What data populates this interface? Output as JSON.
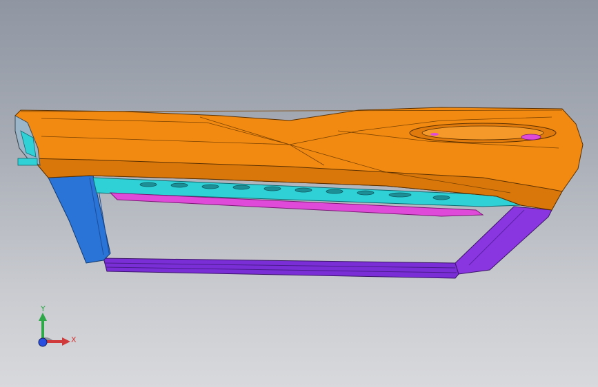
{
  "viewport": {
    "background_top": "#8f96a2",
    "background_bottom": "#d8d9dc"
  },
  "model": {
    "body_color": "#f28a12",
    "body_shade": "#d9770b",
    "left_bracket_color": "#2a74d8",
    "bottom_bracket_color": "#7a2fd6",
    "right_bracket_color": "#8a36e0",
    "inner_panel_color": "#2fd0d6",
    "inner_strip_color": "#e04ad8"
  },
  "triad": {
    "y_label": "Y",
    "x_label": "X",
    "y_color": "#2fa84a",
    "x_color": "#d03a3a",
    "z_color": "#2a4ee0",
    "icons": [
      "y-axis-arrow-icon",
      "x-axis-arrow-icon",
      "z-axis-origin-icon"
    ]
  }
}
